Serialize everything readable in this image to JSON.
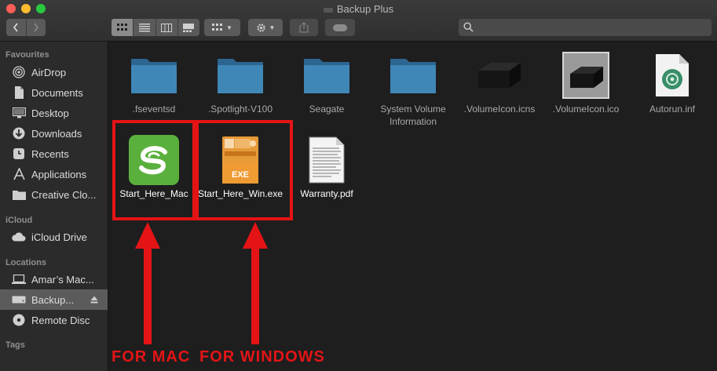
{
  "window": {
    "title": "Backup Plus"
  },
  "toolbar": {
    "back_icon": "chevron-left-icon",
    "forward_icon": "chevron-right-icon",
    "view_icons": [
      "icon-view-icon",
      "list-view-icon",
      "column-view-icon",
      "gallery-view-icon"
    ],
    "arrange_icon": "grid-arrange-icon",
    "action_icon": "gear-icon",
    "share_icon": "share-icon",
    "tag_icon": "tag-icon",
    "search_placeholder": ""
  },
  "sidebar": {
    "sections": [
      {
        "title": "Favourites",
        "items": [
          {
            "label": "AirDrop",
            "icon": "airdrop-icon"
          },
          {
            "label": "Documents",
            "icon": "document-icon"
          },
          {
            "label": "Desktop",
            "icon": "desktop-icon"
          },
          {
            "label": "Downloads",
            "icon": "download-icon"
          },
          {
            "label": "Recents",
            "icon": "clock-icon"
          },
          {
            "label": "Applications",
            "icon": "applications-icon"
          },
          {
            "label": "Creative Clo...",
            "icon": "folder-icon"
          }
        ]
      },
      {
        "title": "iCloud",
        "items": [
          {
            "label": "iCloud Drive",
            "icon": "cloud-icon"
          }
        ]
      },
      {
        "title": "Locations",
        "items": [
          {
            "label": "Amar’s Mac...",
            "icon": "laptop-icon"
          },
          {
            "label": "Backup...",
            "icon": "drive-icon",
            "selected": true
          },
          {
            "label": "Remote Disc",
            "icon": "disc-icon"
          }
        ]
      },
      {
        "title": "Tags",
        "items": []
      }
    ]
  },
  "files": [
    {
      "name": ".fseventsd",
      "icon": "folder-icon"
    },
    {
      "name": ".Spotlight-V100",
      "icon": "folder-icon"
    },
    {
      "name": "Seagate",
      "icon": "folder-icon"
    },
    {
      "name": "System Volume Information",
      "icon": "folder-icon"
    },
    {
      "name": ".VolumeIcon.icns",
      "icon": "drive-image-icon"
    },
    {
      "name": ".VolumeIcon.ico",
      "icon": "drive-image-icon"
    },
    {
      "name": "Autorun.inf",
      "icon": "inf-file-icon"
    },
    {
      "name": "Start_Here_Mac",
      "icon": "seagate-app-icon"
    },
    {
      "name": "Start_Here_Win.exe",
      "icon": "exe-file-icon"
    },
    {
      "name": "Warranty.pdf",
      "icon": "pdf-file-icon"
    }
  ],
  "annotations": {
    "mac_label": "FOR MAC",
    "windows_label": "FOR WINDOWS"
  },
  "colors": {
    "highlight": "#e41416",
    "folder": "#3f87b7",
    "seagate_green": "#5ab03c",
    "exe_orange": "#e79a38"
  }
}
